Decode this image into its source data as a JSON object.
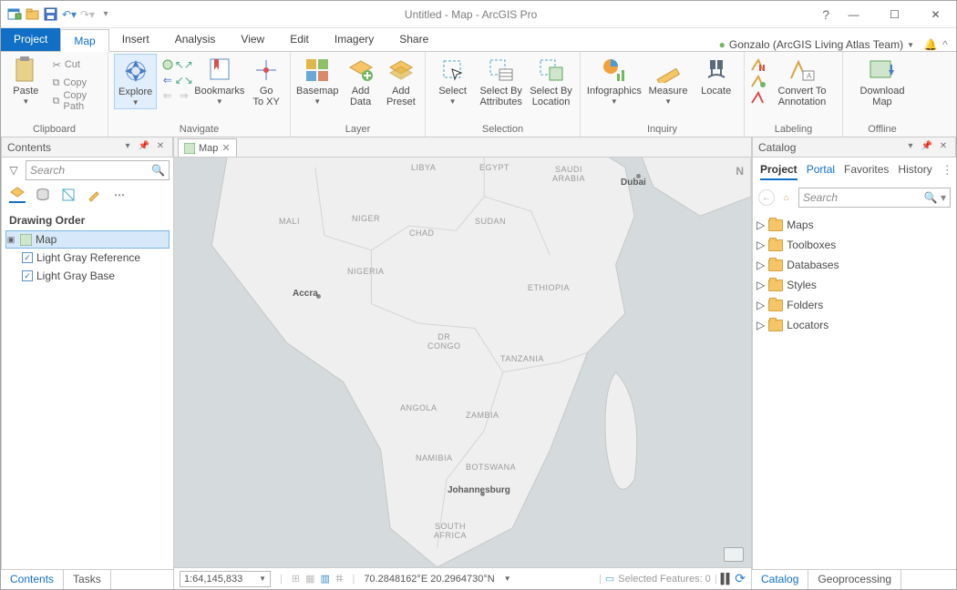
{
  "titlebar": {
    "title": "Untitled - Map - ArcGIS Pro"
  },
  "window": {
    "help": "?",
    "min": "—",
    "max": "☐",
    "close": "✕"
  },
  "tabs": {
    "project": "Project",
    "map": "Map",
    "insert": "Insert",
    "analysis": "Analysis",
    "view": "View",
    "edit": "Edit",
    "imagery": "Imagery",
    "share": "Share"
  },
  "signin": {
    "name": "Gonzalo (ArcGIS Living Atlas Team)",
    "bell": "🔔"
  },
  "ribbon": {
    "clipboard": {
      "label": "Clipboard",
      "paste": "Paste",
      "cut": "Cut",
      "copy": "Copy",
      "copypath": "Copy Path"
    },
    "navigate": {
      "label": "Navigate",
      "explore": "Explore",
      "bookmarks": "Bookmarks",
      "goto": "Go\nTo XY"
    },
    "layer": {
      "label": "Layer",
      "basemap": "Basemap",
      "adddata": "Add\nData",
      "addpreset": "Add\nPreset"
    },
    "selection": {
      "label": "Selection",
      "select": "Select",
      "byattr": "Select By\nAttributes",
      "byloc": "Select By\nLocation"
    },
    "inquiry": {
      "label": "Inquiry",
      "infog": "Infographics",
      "measure": "Measure",
      "locate": "Locate"
    },
    "labeling": {
      "label": "Labeling",
      "conv": "Convert To\nAnnotation"
    },
    "offline": {
      "label": "Offline",
      "dl": "Download\nMap"
    }
  },
  "contents": {
    "title": "Contents",
    "search_placeholder": "Search",
    "section": "Drawing Order",
    "map": "Map",
    "layer1": "Light Gray Reference",
    "layer2": "Light Gray Base",
    "tabs": {
      "contents": "Contents",
      "tasks": "Tasks"
    }
  },
  "mapview": {
    "tab": "Map",
    "countries": {
      "libya": "LIBYA",
      "egypt": "EGYPT",
      "saudi": "SAUDI\nARABIA",
      "mali": "MALI",
      "niger": "NIGER",
      "chad": "CHAD",
      "sudan": "SUDAN",
      "nigeria": "NIGERIA",
      "ethiopia": "ETHIOPIA",
      "drc": "DR\nCONGO",
      "tanzania": "TANZANIA",
      "angola": "ANGOLA",
      "zambia": "ZAMBIA",
      "namibia": "NAMIBIA",
      "botswana": "BOTSWANA",
      "southafrica": "SOUTH\nAFRICA"
    },
    "cities": {
      "dubai": "Dubai",
      "accra": "Accra",
      "johannesburg": "Johannesburg"
    },
    "north": "N"
  },
  "status": {
    "scale": "1:64,145,833",
    "coords": "70.2848162°E 20.2964730°N",
    "selected": "Selected Features: 0"
  },
  "catalog": {
    "title": "Catalog",
    "tabs": {
      "project": "Project",
      "portal": "Portal",
      "favorites": "Favorites",
      "history": "History"
    },
    "search_placeholder": "Search",
    "nodes": [
      "Maps",
      "Toolboxes",
      "Databases",
      "Styles",
      "Folders",
      "Locators"
    ],
    "bottom": {
      "catalog": "Catalog",
      "geoprocessing": "Geoprocessing"
    }
  }
}
